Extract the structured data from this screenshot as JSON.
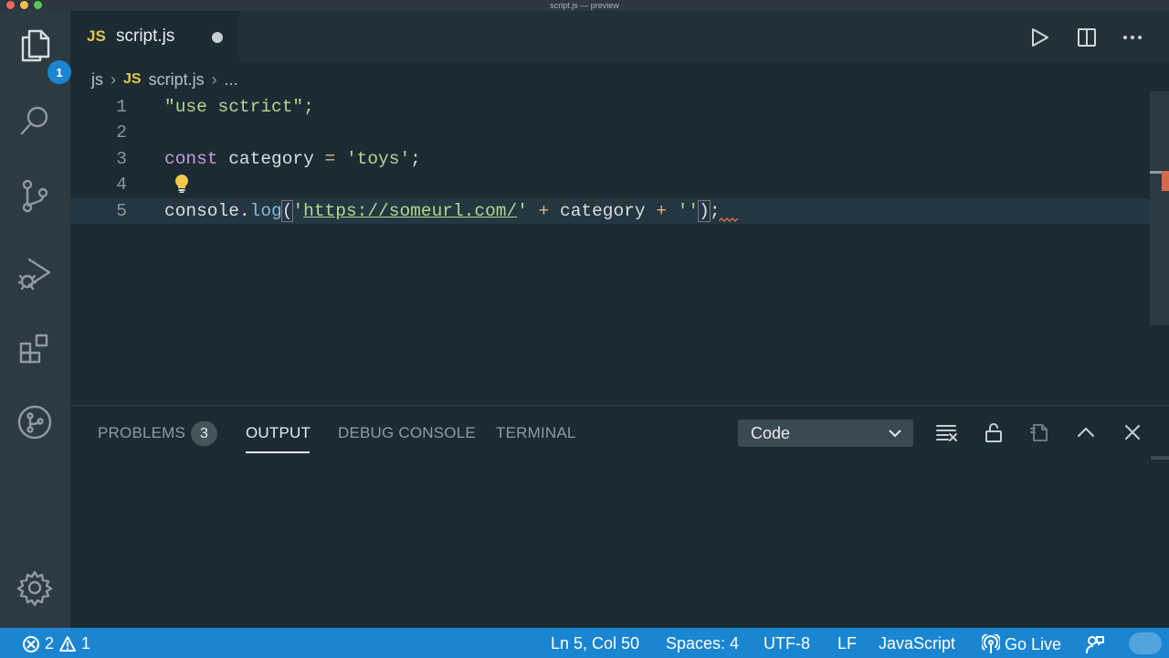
{
  "window": {
    "title": "script.js — preview"
  },
  "activity_bar": {
    "explorer_badge": "1"
  },
  "tab": {
    "icon": "JS",
    "label": "script.js"
  },
  "breadcrumb": {
    "folder": "js",
    "file_icon": "JS",
    "file": "script.js",
    "more": "..."
  },
  "editor": {
    "lines": [
      {
        "number": "1"
      },
      {
        "number": "2"
      },
      {
        "number": "3"
      },
      {
        "number": "4"
      },
      {
        "number": "5"
      }
    ],
    "line1": "\"use sctrict\";",
    "line3": {
      "kw": "const",
      "ident": " category ",
      "op": "=",
      "str": " 'toys'",
      "end": ";"
    },
    "line5": {
      "obj": "console",
      "dot": ".",
      "fn": "log",
      "open": "(",
      "q1": "'",
      "url": "https://someurl.com/",
      "q2": "'",
      "plus1": " + ",
      "ident": "category",
      "plus2": " + ",
      "str": "''",
      "close": ")",
      "end": ";"
    }
  },
  "panel": {
    "tabs": [
      "PROBLEMS",
      "OUTPUT",
      "DEBUG CONSOLE",
      "TERMINAL"
    ],
    "problems_count": "3",
    "active_tab": "OUTPUT",
    "output_channel": "Code"
  },
  "status_bar": {
    "errors": "2",
    "warnings": "1",
    "position": "Ln 5, Col 50",
    "spaces": "Spaces: 4",
    "encoding": "UTF-8",
    "eol": "LF",
    "language": "JavaScript",
    "go_live": "Go Live"
  },
  "colors": {
    "accent": "#1a85d1",
    "editor_bg": "#1b2b34",
    "js_icon": "#e5c845"
  }
}
